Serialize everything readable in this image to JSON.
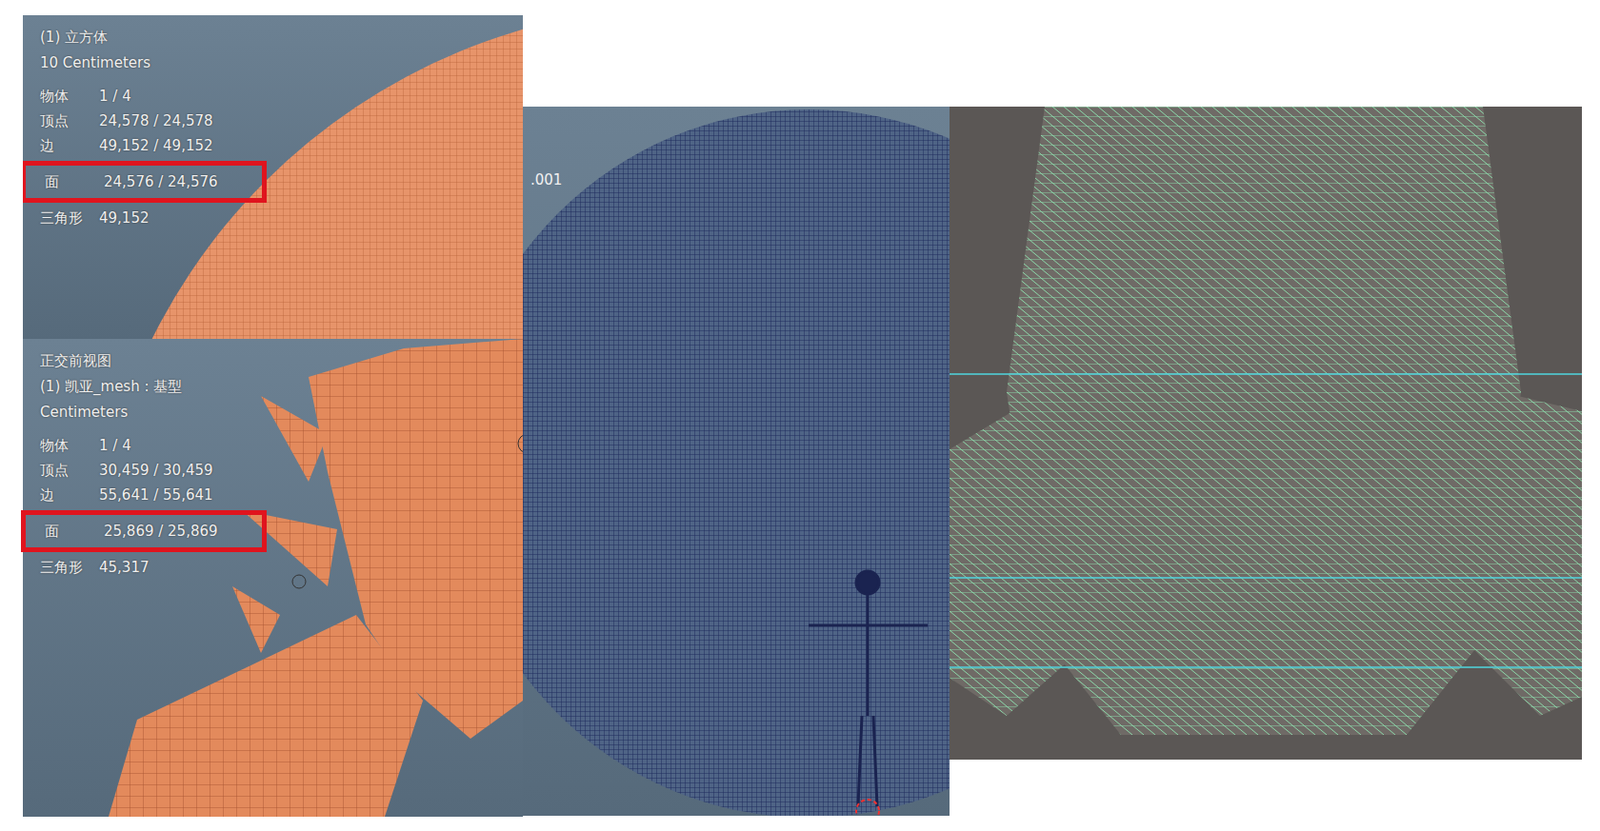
{
  "hud_panels": [
    {
      "view": "",
      "title": "(1) 立方体",
      "units": "10 Centimeters",
      "stats": [
        {
          "label": "物体",
          "value": "1 / 4",
          "highlighted": false
        },
        {
          "label": "顶点",
          "value": "24,578 / 24,578",
          "highlighted": false
        },
        {
          "label": "边",
          "value": "49,152 / 49,152",
          "highlighted": false
        },
        {
          "label": "面",
          "value": "24,576 / 24,576",
          "highlighted": true
        },
        {
          "label": "三角形",
          "value": "49,152",
          "highlighted": false
        }
      ]
    },
    {
      "view": "正交前视图",
      "title": "(1) 凯亚_mesh : 基型",
      "units": "Centimeters",
      "stats": [
        {
          "label": "物体",
          "value": "1 / 4",
          "highlighted": false
        },
        {
          "label": "顶点",
          "value": "30,459 / 30,459",
          "highlighted": false
        },
        {
          "label": "边",
          "value": "55,641 / 55,641",
          "highlighted": false
        },
        {
          "label": "面",
          "value": "25,869 / 25,869",
          "highlighted": true
        },
        {
          "label": "三角形",
          "value": "45,317",
          "highlighted": false
        }
      ]
    }
  ],
  "sphere_viewport": {
    "label": ".001"
  }
}
